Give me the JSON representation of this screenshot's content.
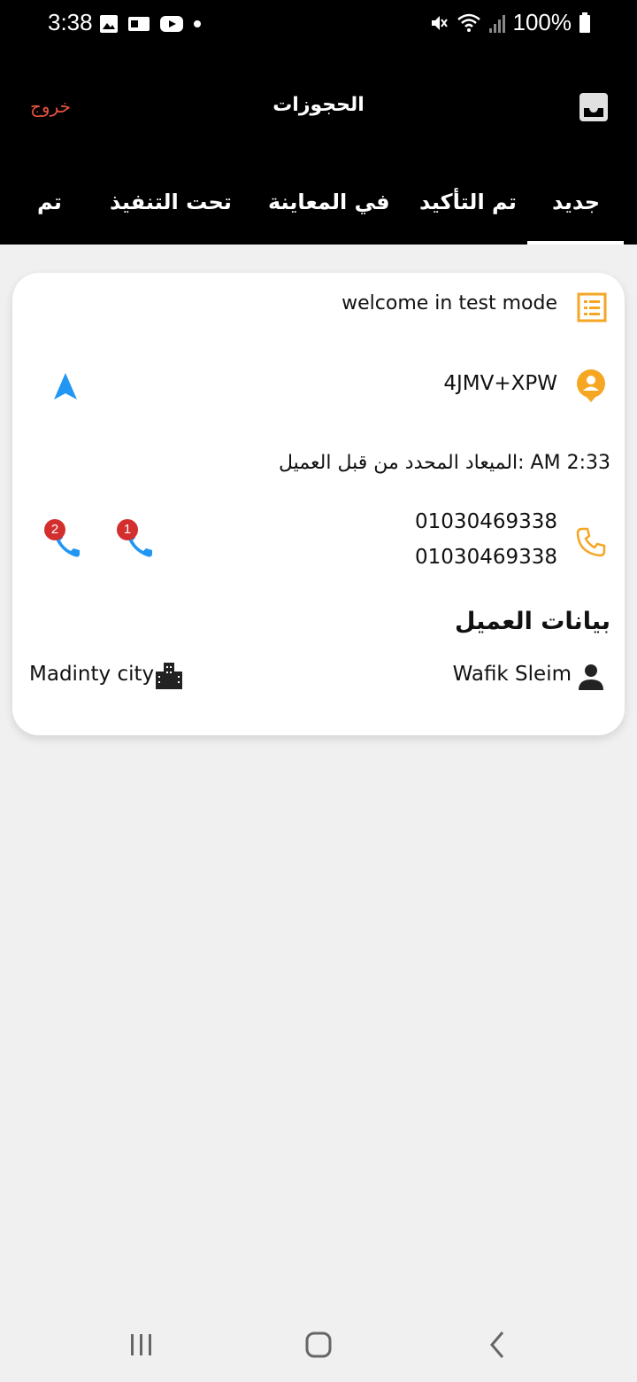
{
  "status_bar": {
    "time": "3:38",
    "battery": "100%"
  },
  "app_bar": {
    "title": "الحجوزات",
    "logout_label": "خروج"
  },
  "tabs": [
    {
      "label": "جديد"
    },
    {
      "label": "تم التأكيد"
    },
    {
      "label": "في المعاينة"
    },
    {
      "label": "تحت التنفيذ"
    },
    {
      "label": "تم"
    }
  ],
  "booking": {
    "note": "welcome in test mode",
    "location_code": "4JMV+XPW",
    "appointment": "الميعاد المحدد من قبل العميل: AM 2:33",
    "phones": [
      "01030469338",
      "01030469338"
    ],
    "call_badges": [
      "2",
      "1"
    ],
    "section_title": "بيانات العميل",
    "client_name": "Wafik Sleim",
    "city": "Madinty city"
  },
  "colors": {
    "accent_orange": "#f5a623",
    "call_blue": "#2196f3",
    "logout_red": "#e5533d"
  }
}
